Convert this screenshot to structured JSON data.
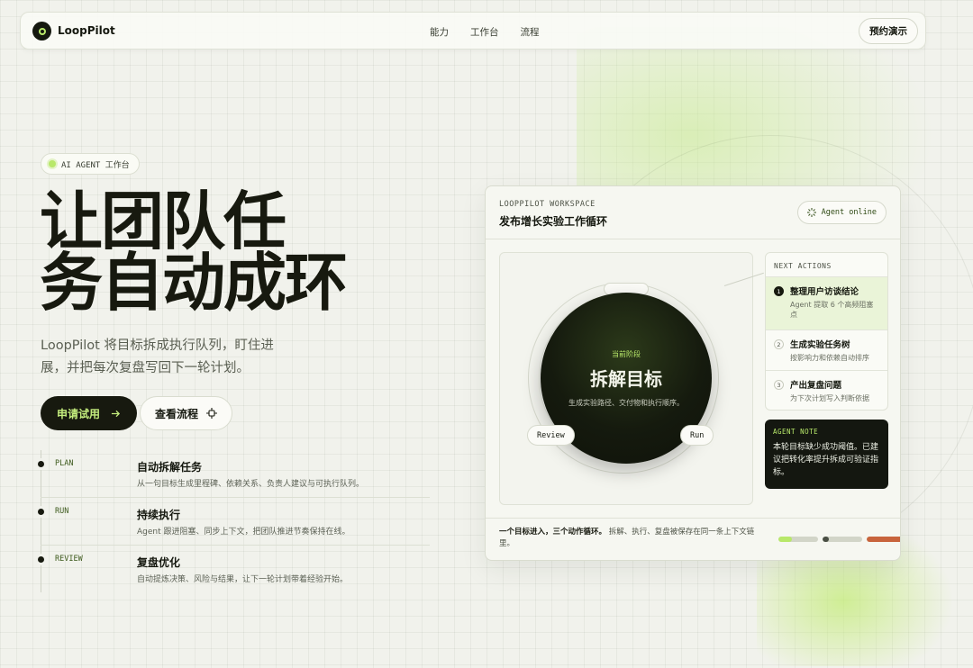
{
  "nav": {
    "brand": "LoopPilot",
    "links": [
      "能力",
      "工作台",
      "流程"
    ],
    "demo_label": "预约演示"
  },
  "hero": {
    "badge": "AI AGENT 工作台",
    "headline_line1": "让团队任",
    "headline_line2": "务自动成环",
    "subtitle": "LoopPilot 将目标拆成执行队列，盯住进展，并把每次复盘写回下一轮计划。",
    "primary_label": "申请试用",
    "secondary_label": "查看流程"
  },
  "timeline": [
    {
      "tag": "PLAN",
      "title": "自动拆解任务",
      "desc": "从一句目标生成里程碑、依赖关系、负责人建议与可执行队列。"
    },
    {
      "tag": "RUN",
      "title": "持续执行",
      "desc": "Agent 跟进阻塞、同步上下文，把团队推进节奏保持在线。"
    },
    {
      "tag": "REVIEW",
      "title": "复盘优化",
      "desc": "自动提炼决策、风险与结果，让下一轮计划带着经验开始。"
    }
  ],
  "workspace": {
    "eyebrow": "LOOPPILOT WORKSPACE",
    "title": "发布增长实验工作循环",
    "status": "Agent online",
    "stage": {
      "eyebrow": "当前阶段",
      "title": "拆解目标",
      "desc": "生成实验路径、交付物和执行顺序。"
    },
    "pills": {
      "review": "Review",
      "run": "Run"
    },
    "actions_head": "NEXT ACTIONS",
    "actions": [
      {
        "num": "1",
        "title": "整理用户访谈结论",
        "desc": "Agent 提取 6 个高频阻塞点"
      },
      {
        "num": "2",
        "title": "生成实验任务树",
        "desc": "按影响力和依赖自动排序"
      },
      {
        "num": "3",
        "title": "产出复盘问题",
        "desc": "为下次计划写入判断依据"
      }
    ],
    "note_head": "AGENT NOTE",
    "note_text": "本轮目标缺少成功阈值。已建议把转化率提升拆成可验证指标。",
    "foot_bold": "一个目标进入，三个动作循环。",
    "foot_text": "拆解、执行、复盘被保存在同一条上下文链里。",
    "progress": [
      {
        "value": 0.35,
        "color": "#b8e86a"
      },
      {
        "value": 0.15,
        "color": "#4a4f44"
      },
      {
        "value": 1.0,
        "color": "#c8643c"
      }
    ]
  }
}
